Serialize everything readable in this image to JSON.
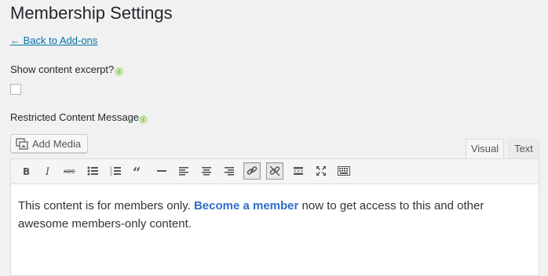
{
  "page": {
    "title": "Membership Settings",
    "back_link": "← Back to Add-ons"
  },
  "fields": {
    "show_excerpt_label": "Show content excerpt?",
    "show_excerpt_checked": false,
    "restricted_label": "Restricted Content Message",
    "info_glyph": "i"
  },
  "editor": {
    "add_media_label": "Add Media",
    "tabs": {
      "visual": "Visual",
      "text": "Text"
    },
    "active_tab": "Visual",
    "toolbar": [
      "bold-icon",
      "italic-icon",
      "strikethrough-icon",
      "bullet-list-icon",
      "numbered-list-icon",
      "blockquote-icon",
      "horizontal-rule-icon",
      "align-left-icon",
      "align-center-icon",
      "align-right-icon",
      "insert-link-icon",
      "remove-link-icon",
      "read-more-icon",
      "fullscreen-icon",
      "toolbar-toggle-icon"
    ],
    "content": {
      "before": "This content is for members only. ",
      "link": "Become a member",
      "after": " now to get access to this and other awesome members-only content."
    }
  },
  "colors": {
    "link": "#0073aa",
    "content_link": "#2e6fc9",
    "info_badge": "#c4e3a3"
  }
}
